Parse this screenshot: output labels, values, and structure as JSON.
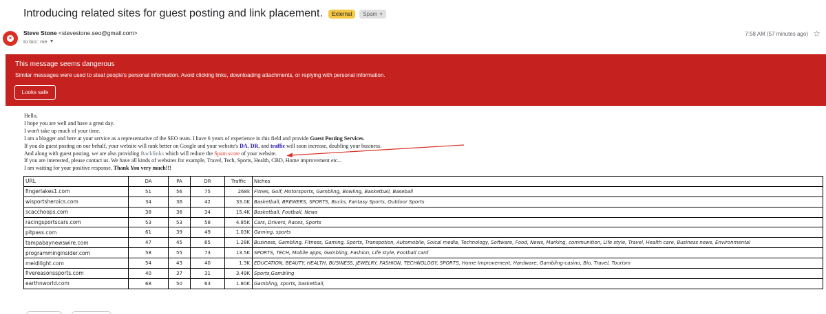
{
  "email": {
    "subject": "Introducing related sites for guest posting and link placement.",
    "labels": {
      "external": "External",
      "spam": "Spam"
    },
    "sender_name": "Steve Stone",
    "sender_email": "<stevestone.seo@gmail.com>",
    "recipients": "to bcc: me",
    "timestamp": "7:58 AM (57 minutes ago)"
  },
  "warning": {
    "title": "This message seems dangerous",
    "text": "Similar messages were used to steal people's personal information. Avoid clicking links, downloading attachments, or replying with personal information.",
    "button": "Looks safe"
  },
  "body": {
    "l1": "Hello,",
    "l2": "I hope you are well and have a great day.",
    "l3": "I won't take up much of your time.",
    "l4a": "I am a blogger and here at your service as a representative of the SEO team. I have 6 years of experience in this field and provide ",
    "l4b": "Guest Posting Services",
    "l4c": ".",
    "l5a": "If you do guest posting on our behalf, your website will rank better on Google and your website's ",
    "l5b": "DA",
    "l5c": ", ",
    "l5d": "DR",
    "l5e": ", and ",
    "l5f": "traffic",
    "l5g": " will soon increase, doubling your business.",
    "l6a": "And along with guest posting, we are also providing ",
    "l6b": "Backlinks",
    "l6c": " which will reduce the ",
    "l6d": "Spam score",
    "l6e": " of your website.",
    "l7": "If you are interested, please contact us. We have all kinds of websites for example, Travel, Tech, Sports, Health, CBD, Home improvement etc...",
    "l8a": "I am waiting for your positive response. ",
    "l8b": "Thank You very much!!!"
  },
  "table": {
    "headers": {
      "url": "URL",
      "da": "DA",
      "pa": "PA",
      "dr": "DR",
      "traffic": "Traffic",
      "niches": "Niches"
    },
    "rows": [
      {
        "url": "fingerlakes1.com",
        "da": "51",
        "pa": "56",
        "dr": "75",
        "traffic": "268k",
        "niches": "Fitnes, Golf, Motorsports, Gambling, Bowling, Basketball, Baseball"
      },
      {
        "url": "wisportsheroics.com",
        "da": "34",
        "pa": "36",
        "dr": "42",
        "traffic": "33.0K",
        "niches": "Basketball, BREWERS, SPORTS, Bucks, Fantasy Sports, Outdoor Sports"
      },
      {
        "url": "scacchoops.com",
        "da": "38",
        "pa": "36",
        "dr": "34",
        "traffic": "15.4K",
        "niches": "Basketball, Football, News"
      },
      {
        "url": "racingsportscars.com",
        "da": "53",
        "pa": "53",
        "dr": "58",
        "traffic": "4.85K",
        "niches": "Cars, Drivers, Races, Sports"
      },
      {
        "url": "pitpass.com",
        "da": "61",
        "pa": "39",
        "dr": "49",
        "traffic": "1.03K",
        "niches": "Gaming, sports"
      },
      {
        "url": "tampabaynewswire.com",
        "da": "47",
        "pa": "45",
        "dr": "65",
        "traffic": "1.28K",
        "niches": "Business, Gambling, Fitness, Gaming, Sports, Transpotion, Automobile, Soical media, Technology, Software, Food, News, Marking, communition, Life style, Travel, Health care, Business news, Environmental"
      },
      {
        "url": "programminginsider.com",
        "da": "58",
        "pa": "55",
        "dr": "73",
        "traffic": "13.5K",
        "niches": "SPORTS, TECH, Mobile apps, Gambling, Fashion, Life style, Football card"
      },
      {
        "url": "meidilight.com",
        "da": "54",
        "pa": "43",
        "dr": "40",
        "traffic": "1.3K",
        "niches": "EDUCATION, BEAUTY, HEALTH, BUSINESS, JEWELRY, FASHION, TECHNOLOGY, SPORTS, Home Improvement, Hardware, Gambling-casino, Bio, Travel, Tourism"
      },
      {
        "url": "fivereasonssports.com",
        "da": "40",
        "pa": "37",
        "dr": "31",
        "traffic": "3.49K",
        "niches": "Sports,Gambling"
      },
      {
        "url": "earthnworld.com",
        "da": "68",
        "pa": "50",
        "dr": "63",
        "traffic": "1.80K",
        "niches": "Gambling, sports, basketball,"
      }
    ]
  },
  "colors": {
    "warning_bg": "#c5221f",
    "external_label": "#f6c744",
    "link_blue": "#1a0dab",
    "annotation_arrow": "#d93025"
  },
  "icons": {
    "avatar": "danger-x-icon",
    "star": "star-icon",
    "spam_close": "close-icon",
    "recipients_caret": "caret-down-icon"
  }
}
